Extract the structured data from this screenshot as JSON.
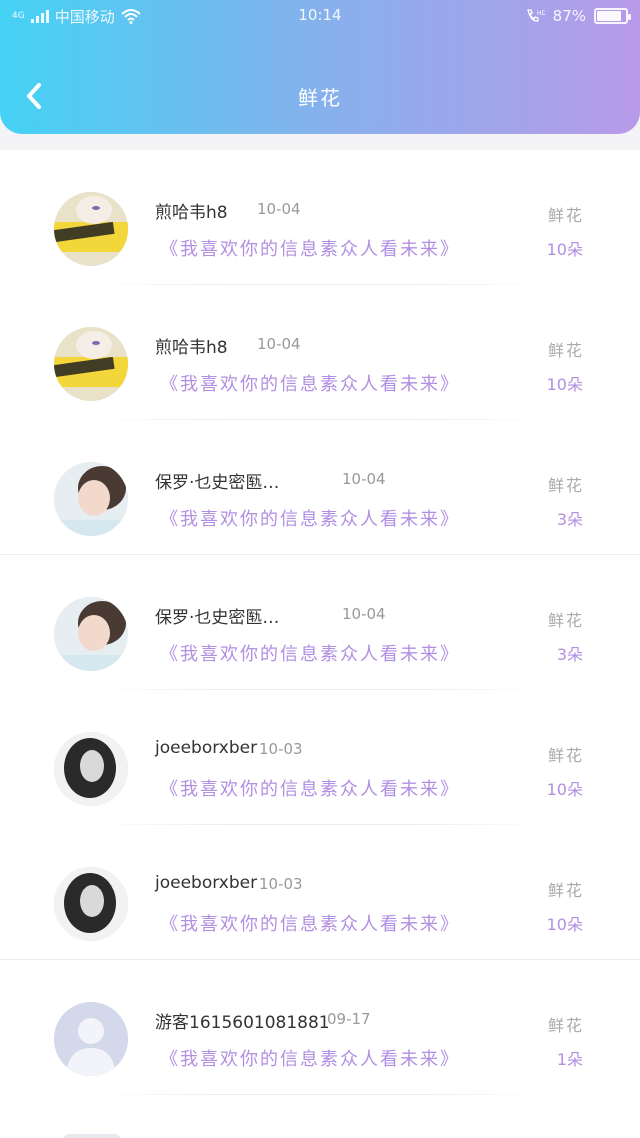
{
  "status_bar": {
    "network": "4G",
    "carrier": "中国移动",
    "time": "10:14",
    "call_tag": "HD",
    "battery": "87%",
    "battery_level": 0.87
  },
  "header": {
    "title": "鲜花",
    "gradient": [
      "#44d2f5",
      "#b89ae9"
    ]
  },
  "items": [
    {
      "name": "煎哈韦h8",
      "date": "10-04",
      "message": "《我喜欢你的信息素众人看未来》",
      "type": "鲜花",
      "count": "10朵"
    },
    {
      "name": "煎哈韦h8",
      "date": "10-04",
      "message": "《我喜欢你的信息素众人看未来》",
      "type": "鲜花",
      "count": "10朵"
    },
    {
      "name": "保罗·乜史密匦…",
      "date": "10-04",
      "message": "《我喜欢你的信息素众人看未来》",
      "type": "鲜花",
      "count": "3朵"
    },
    {
      "name": "保罗·乜史密匦…",
      "date": "10-04",
      "message": "《我喜欢你的信息素众人看未来》",
      "type": "鲜花",
      "count": "3朵"
    },
    {
      "name": "joeeborxber",
      "date": "10-03",
      "message": "《我喜欢你的信息素众人看未来》",
      "type": "鲜花",
      "count": "10朵"
    },
    {
      "name": "joeeborxber",
      "date": "10-03",
      "message": "《我喜欢你的信息素众人看未来》",
      "type": "鲜花",
      "count": "10朵"
    },
    {
      "name": "游客1615601081881",
      "date": "09-17",
      "message": "《我喜欢你的信息素众人看未来》",
      "type": "鲜花",
      "count": "1朵"
    }
  ],
  "colors": {
    "accent": "#b18fe2",
    "name": "#333333",
    "muted": "#999999"
  }
}
